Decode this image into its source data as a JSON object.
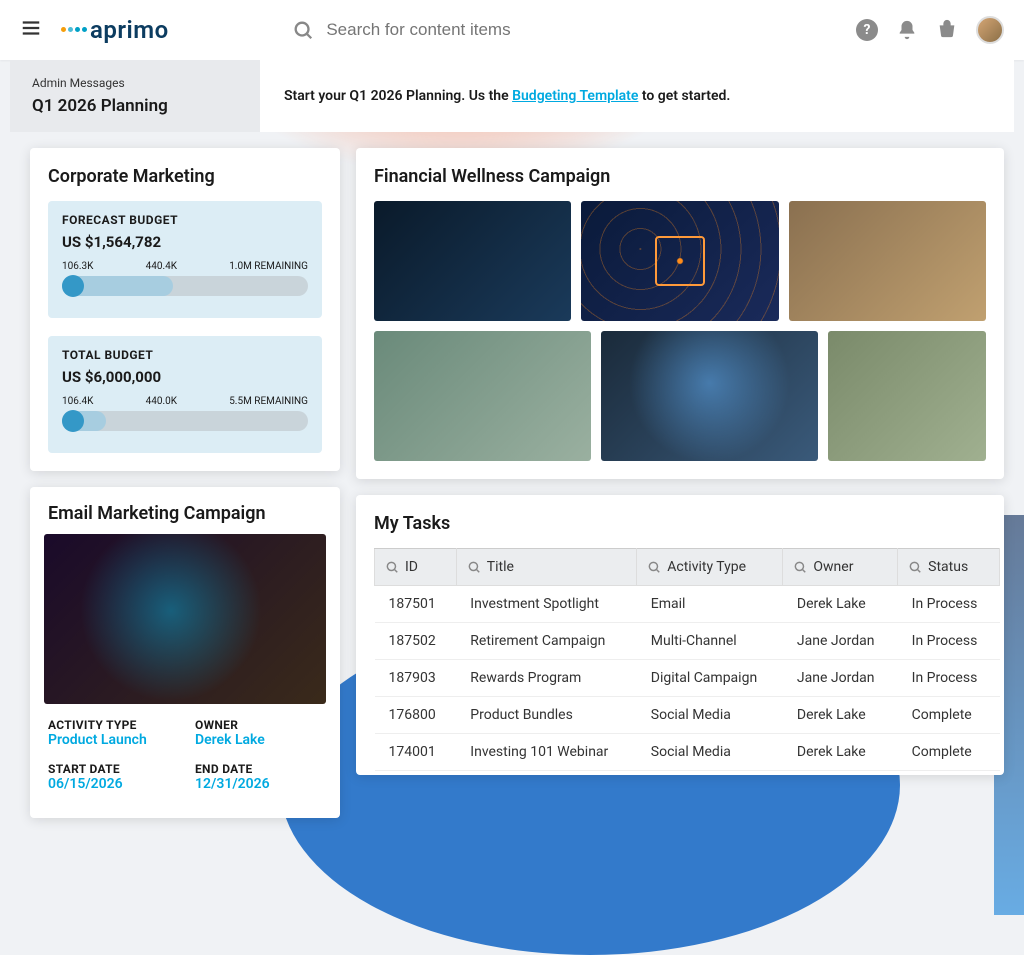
{
  "header": {
    "logo_text": "aprimo",
    "search_placeholder": "Search for content items"
  },
  "subheader": {
    "admin_label": "Admin Messages",
    "admin_title": "Q1 2026 Planning",
    "message_pre": "Start your Q1 2026 Planning. Us the ",
    "message_link": "Budgeting Template",
    "message_post": " to get started."
  },
  "corporate_marketing": {
    "title": "Corporate Marketing",
    "forecast": {
      "label": "FORECAST BUDGET",
      "amount": "US $1,564,782",
      "tick1": "106.3K",
      "tick2": "440.4K",
      "tick3": "1.0M REMAINING"
    },
    "total": {
      "label": "TOTAL BUDGET",
      "amount": "US $6,000,000",
      "tick1": "106.4K",
      "tick2": "440.0K",
      "tick3": "5.5M REMAINING"
    }
  },
  "campaign": {
    "title": "Financial Wellness Campaign"
  },
  "email_marketing": {
    "title": "Email Marketing Campaign",
    "activity_type_label": "ACTIVITY TYPE",
    "activity_type": "Product Launch",
    "owner_label": "OWNER",
    "owner": "Derek Lake",
    "start_date_label": "START DATE",
    "start_date": "06/15/2026",
    "end_date_label": "END DATE",
    "end_date": "12/31/2026"
  },
  "tasks": {
    "title": "My Tasks",
    "columns": {
      "id": "ID",
      "title": "Title",
      "activity": "Activity Type",
      "owner": "Owner",
      "status": "Status"
    },
    "rows": [
      {
        "id": "187501",
        "title": "Investment Spotlight",
        "activity": "Email",
        "owner": "Derek Lake",
        "status": "In Process"
      },
      {
        "id": "187502",
        "title": "Retirement Campaign",
        "activity": "Multi-Channel",
        "owner": "Jane Jordan",
        "status": "In Process"
      },
      {
        "id": "187903",
        "title": "Rewards Program",
        "activity": "Digital Campaign",
        "owner": "Jane Jordan",
        "status": "In Process"
      },
      {
        "id": "176800",
        "title": "Product Bundles",
        "activity": "Social Media",
        "owner": "Derek Lake",
        "status": "Complete"
      },
      {
        "id": "174001",
        "title": "Investing 101 Webinar",
        "activity": "Social Media",
        "owner": "Derek Lake",
        "status": "Complete"
      }
    ]
  }
}
